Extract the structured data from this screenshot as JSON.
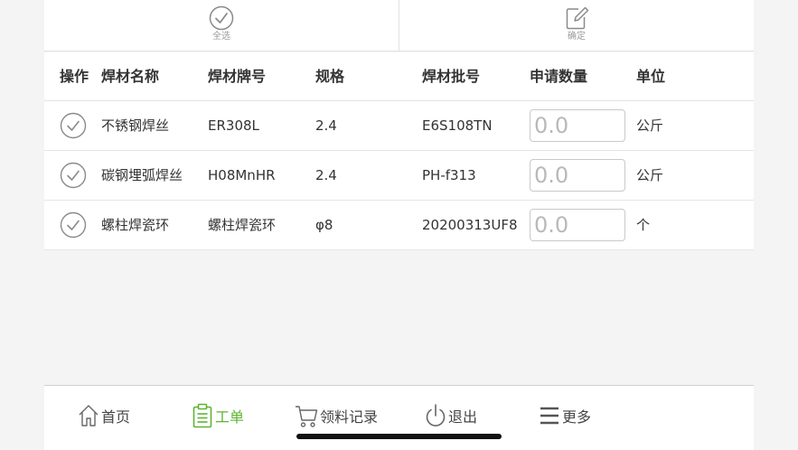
{
  "toolbar": {
    "select_all_label": "全选",
    "confirm_label": "确定"
  },
  "table": {
    "headers": [
      "操作",
      "焊材名称",
      "焊材牌号",
      "规格",
      "焊材批号",
      "申请数量",
      "单位"
    ],
    "rows": [
      {
        "name": "不锈钢焊丝",
        "grade": "ER308L",
        "spec": "2.4",
        "batch": "E6S108TN",
        "qty_placeholder": "0.0",
        "unit": "公斤"
      },
      {
        "name": "碳钢埋弧焊丝",
        "grade": "H08MnHR",
        "spec": "2.4",
        "batch": "PH-f313",
        "qty_placeholder": "0.0",
        "unit": "公斤"
      },
      {
        "name": "螺柱焊瓷环",
        "grade": "螺柱焊瓷环",
        "spec": "φ8",
        "batch": "20200313UF8",
        "qty_placeholder": "0.0",
        "unit": "个"
      }
    ]
  },
  "nav": {
    "items": [
      {
        "label": "首页",
        "icon": "home-icon"
      },
      {
        "label": "工单",
        "icon": "clipboard-icon",
        "active": true
      },
      {
        "label": "领料记录",
        "icon": "cart-icon"
      },
      {
        "label": "退出",
        "icon": "power-icon"
      },
      {
        "label": "更多",
        "icon": "menu-icon"
      }
    ]
  },
  "colors": {
    "accent": "#5cb531",
    "icon_gray": "#8a8a8a",
    "placeholder": "#b9b9b9"
  }
}
